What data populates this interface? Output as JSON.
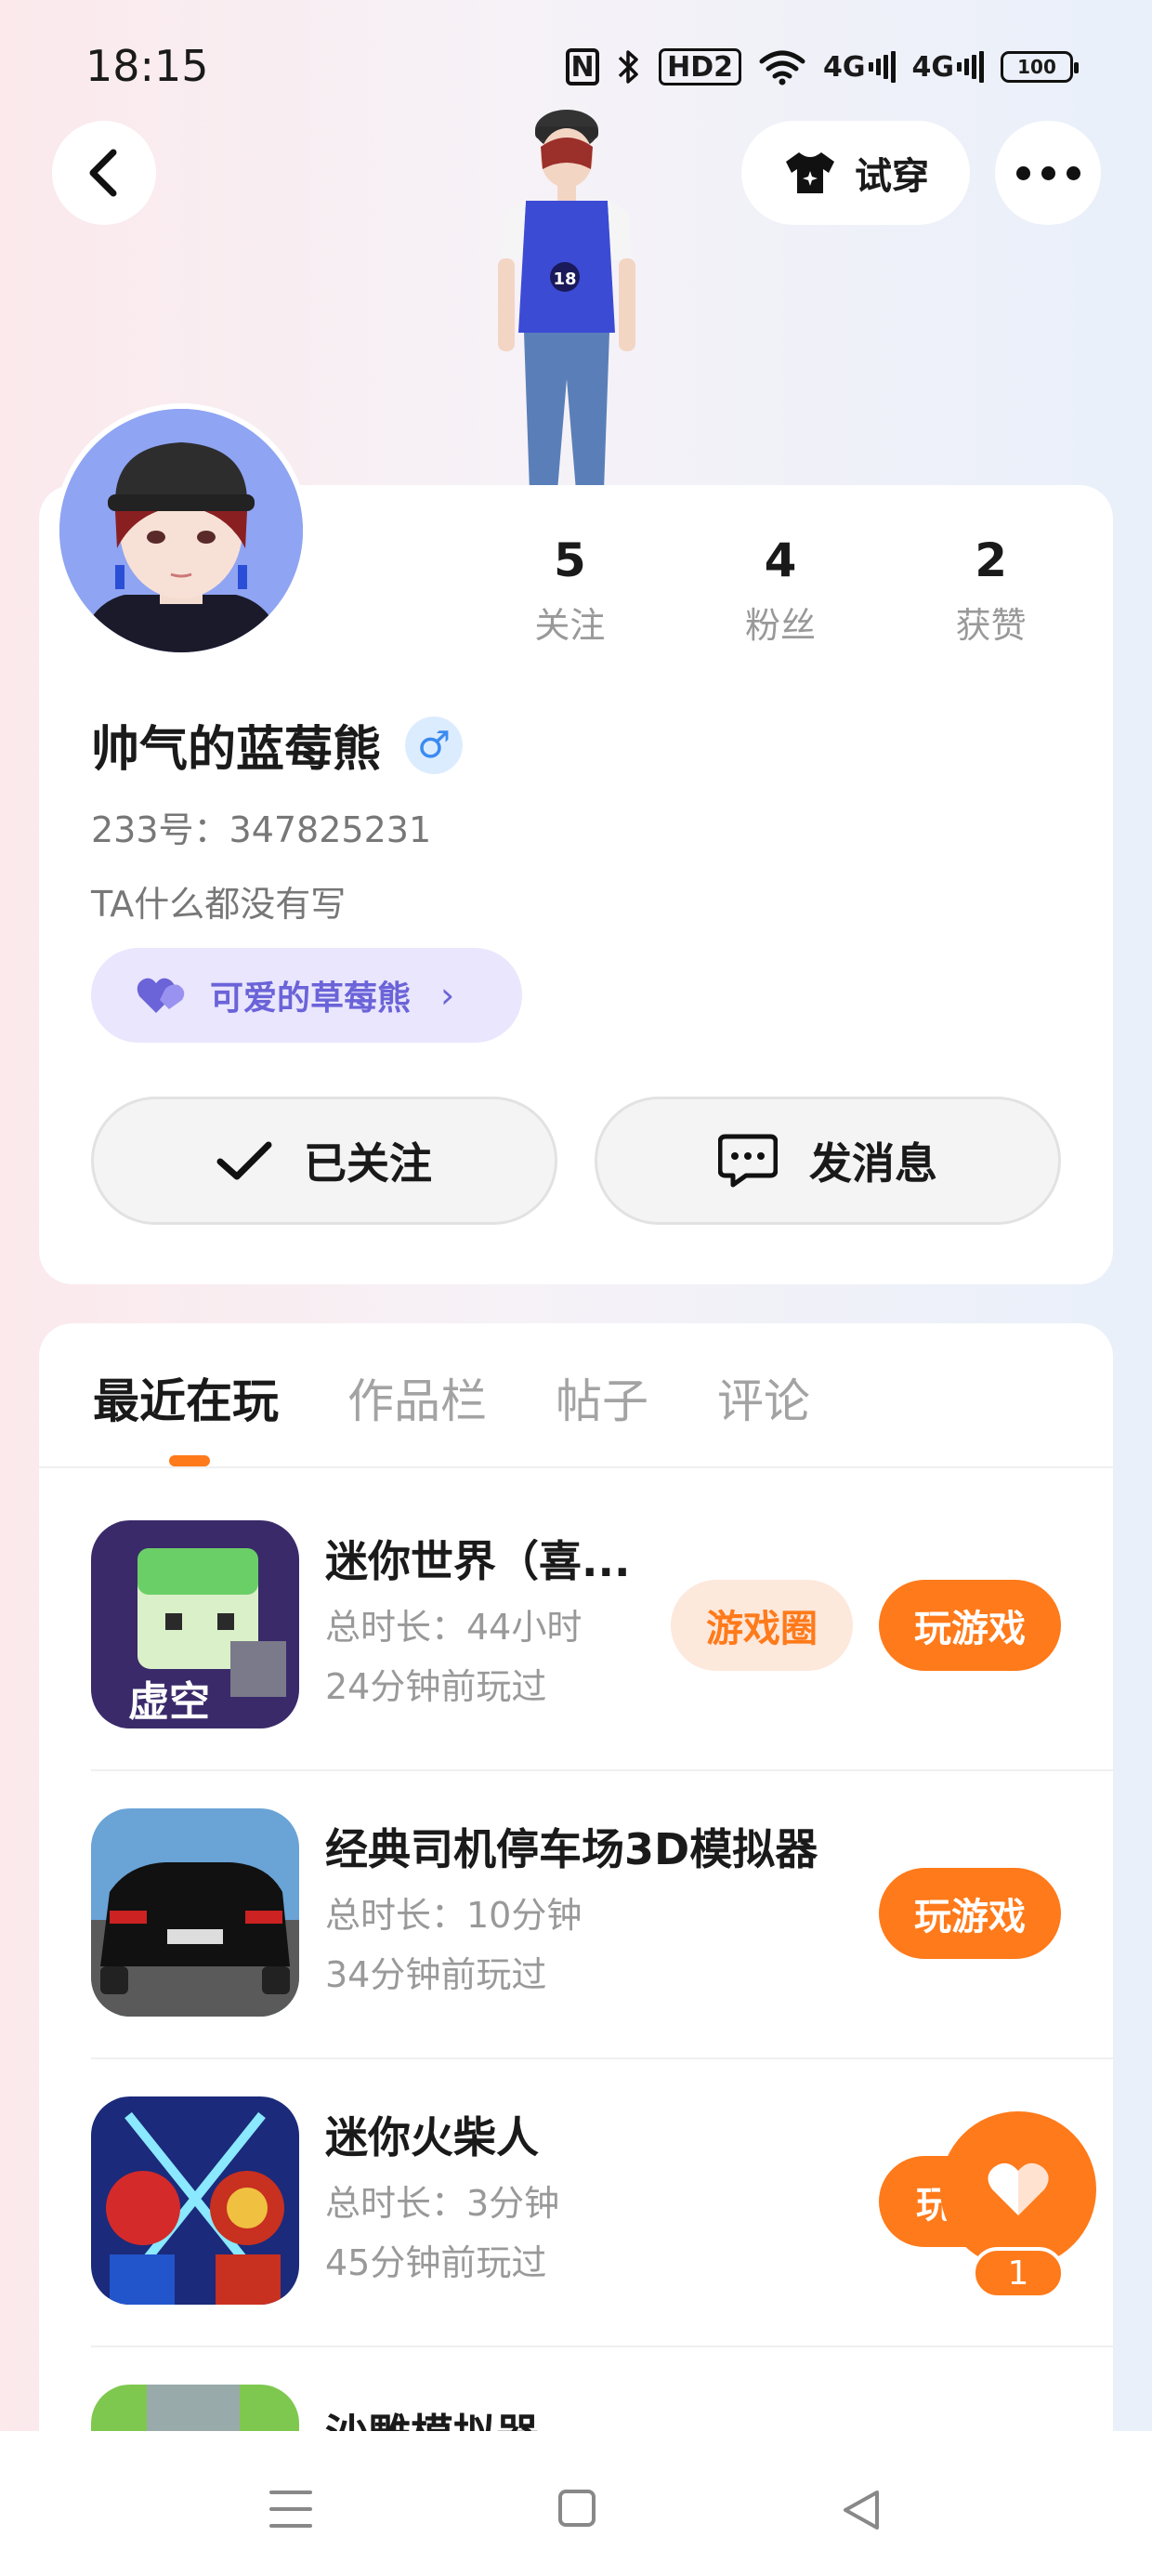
{
  "status_bar": {
    "time": "18:15",
    "nfc": "N",
    "hd": "HD2",
    "sig1": "4G",
    "sig2": "4G",
    "battery": "100"
  },
  "header": {
    "try_on_label": "试穿"
  },
  "profile": {
    "stats": [
      {
        "value": "5",
        "label": "关注"
      },
      {
        "value": "4",
        "label": "粉丝"
      },
      {
        "value": "2",
        "label": "获赞"
      }
    ],
    "nickname": "帅气的蓝莓熊",
    "gender_symbol": "♂",
    "uid": "233号：347825231",
    "bio": "TA什么都没有写",
    "tag": "可爱的草莓熊",
    "follow_label": "已关注",
    "message_label": "发消息"
  },
  "tabs": [
    "最近在玩",
    "作品栏",
    "帖子",
    "评论"
  ],
  "games": [
    {
      "name": "迷你世界（喜...",
      "duration": "总时长：44小时",
      "last_played": "24分钟前玩过",
      "circle_label": "游戏圈",
      "play_label": "玩游戏",
      "icon_text": "虚空"
    },
    {
      "name": "经典司机停车场3D模拟器",
      "duration": "总时长：10分钟",
      "last_played": "34分钟前玩过",
      "play_label": "玩游戏"
    },
    {
      "name": "迷你火柴人",
      "duration": "总时长：3分钟",
      "last_played": "45分钟前玩过",
      "play_label": "玩"
    },
    {
      "name": "沙雕模拟器"
    }
  ],
  "like": {
    "count": "1"
  },
  "colors": {
    "accent": "#ff7a1a",
    "tag_purple": "#6b63d8",
    "gender_blue": "#3b8bf0"
  }
}
